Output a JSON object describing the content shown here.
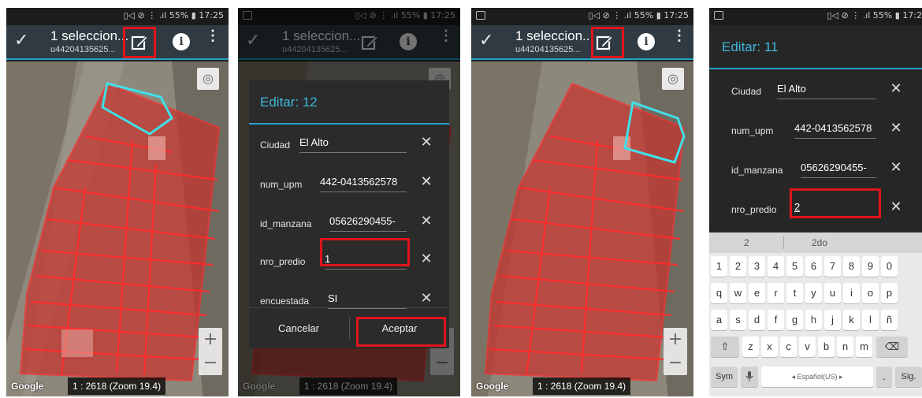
{
  "status_bar": {
    "right": "▯◁ ⊘ ⋮ .ıl 55% ▮ 17:25",
    "right_cut": "▯◁ ⊘ ⋮ .ıl 55% ▮ 17:2"
  },
  "appbar": {
    "title": "1 seleccion...",
    "subtitle": "u44204135625...",
    "check_icon": "✓",
    "info_icon": "i",
    "more_icon": "⋮"
  },
  "map": {
    "google": "Google",
    "scale": "1 : 2618 (Zoom 19.4)",
    "zoom_in": "+",
    "zoom_out": "−",
    "locate_icon": "◎",
    "colors": {
      "parcel_fill": "#c8332e",
      "parcel_stroke": "#ff2a2a",
      "selected_stroke": "#3fe0e8"
    }
  },
  "dialog": {
    "title": "Editar: 12",
    "fields": [
      {
        "label": "Ciudad",
        "value": "El Alto"
      },
      {
        "label": "num_upm",
        "value": "442-0413562578"
      },
      {
        "label": "id_manzana",
        "value": "05626290455-"
      },
      {
        "label": "nro_predio",
        "value": "1"
      },
      {
        "label": "encuestada",
        "value": "SI"
      }
    ],
    "clear_icon": "✕",
    "cancel": "Cancelar",
    "accept": "Aceptar"
  },
  "dialog2": {
    "title": "Editar: 11",
    "fields": [
      {
        "label": "Ciudad",
        "value": "El Alto"
      },
      {
        "label": "num_upm",
        "value": "442-0413562578"
      },
      {
        "label": "id_manzana",
        "value": "05626290455-"
      },
      {
        "label": "nro_predio",
        "value": "2"
      }
    ]
  },
  "keyboard": {
    "suggestions": [
      "2",
      "2do"
    ],
    "row_numbers": [
      "1",
      "2",
      "3",
      "4",
      "5",
      "6",
      "7",
      "8",
      "9",
      "0"
    ],
    "row1": [
      "q",
      "w",
      "e",
      "r",
      "t",
      "y",
      "u",
      "i",
      "o",
      "p"
    ],
    "row2": [
      "a",
      "s",
      "d",
      "f",
      "g",
      "h",
      "j",
      "k",
      "l",
      "ñ"
    ],
    "row3": [
      "z",
      "x",
      "c",
      "v",
      "b",
      "n",
      "m"
    ],
    "shift": "⇧",
    "backspace": "⌫",
    "sym": "Sym",
    "mic": "🎤",
    "space": "◂ Español(US) ▸",
    "period": ".",
    "next": "Sig."
  }
}
